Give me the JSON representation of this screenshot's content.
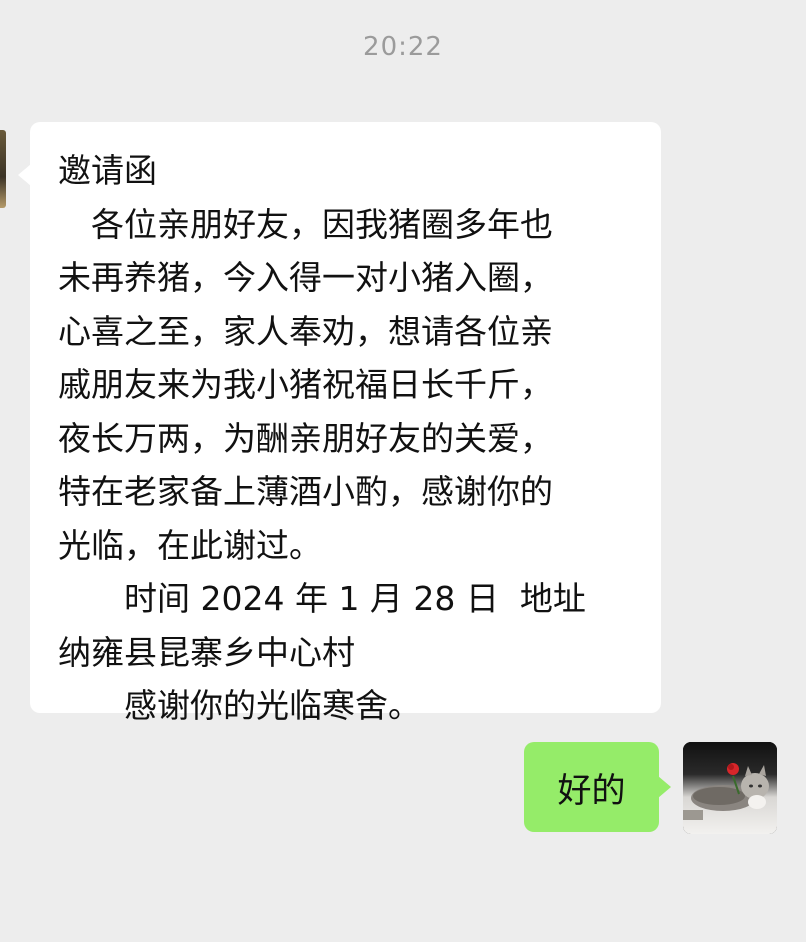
{
  "chat": {
    "timestamp": "20:22",
    "incoming": {
      "lines": [
        "邀请函",
        "　各位亲朋好友，因我猪圈多年也",
        "未再养猪，今入得一对小猪入圈，",
        "心喜之至，家人奉劝，想请各位亲",
        "戚朋友来为我小猪祝福日长千斤，",
        "夜长万两，为酬亲朋好友的关爱，",
        "特在老家备上薄酒小酌，感谢你的",
        "光临，在此谢过。",
        "　　时间 2024 年 1 月 28 日  地址",
        "纳雍县昆寨乡中心村",
        "　　感谢你的光临寒舍。"
      ]
    },
    "outgoing": {
      "text": "好的"
    },
    "avatar": {
      "icon": "cat-with-rose-avatar"
    }
  }
}
